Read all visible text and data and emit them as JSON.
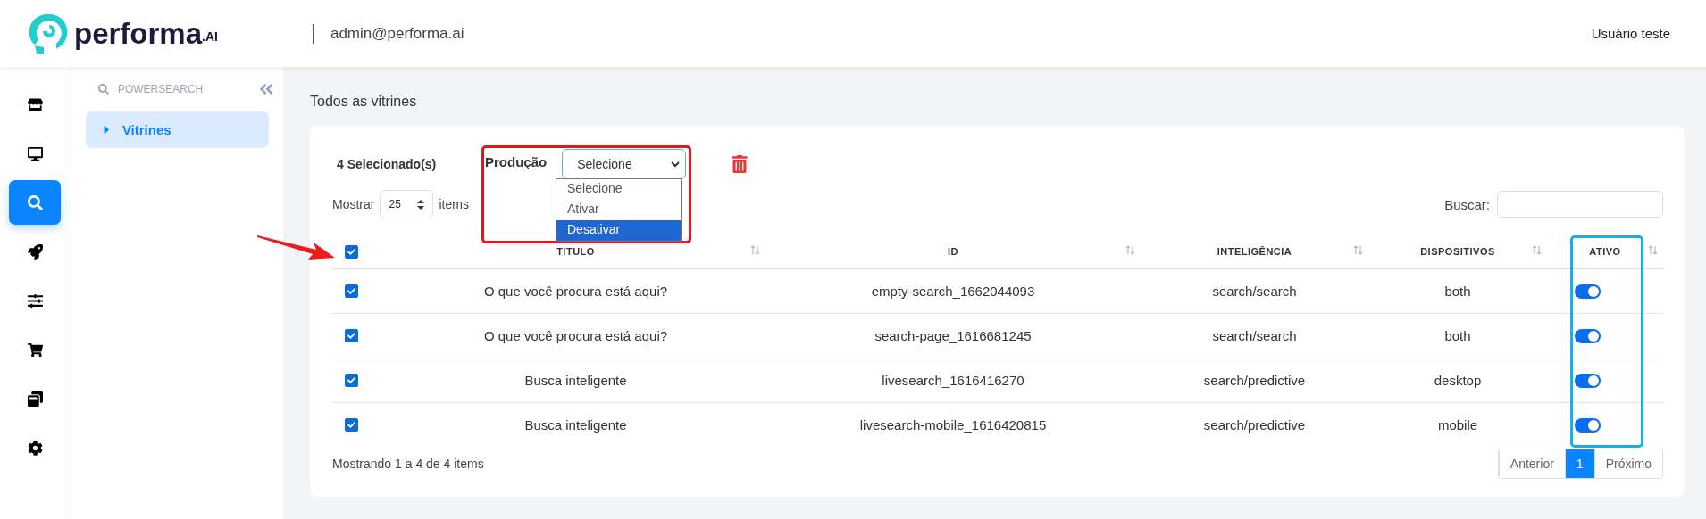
{
  "header": {
    "logo": {
      "name": "performa",
      "suffix": ".AI"
    },
    "account": "admin@performa.ai",
    "user": "Usuário teste"
  },
  "rail": [
    {
      "kind": "store",
      "selected": false
    },
    {
      "kind": "monitor",
      "selected": false
    },
    {
      "kind": "search",
      "selected": true
    },
    {
      "kind": "rocket",
      "selected": false
    },
    {
      "kind": "sliders",
      "selected": false
    },
    {
      "kind": "cart",
      "selected": false
    },
    {
      "kind": "windows",
      "selected": false
    },
    {
      "kind": "gear",
      "selected": false
    }
  ],
  "sidebar": {
    "section": "POWERSEARCH",
    "items": [
      {
        "label": "Vitrines",
        "selected": true
      }
    ]
  },
  "page_title": "Todos as vitrines",
  "bulk": {
    "count": "4 Selecionado(s)",
    "label": "Produção",
    "value": "Selecione",
    "options": [
      {
        "label": "Selecione",
        "highlighted": false
      },
      {
        "label": "Ativar",
        "highlighted": false
      },
      {
        "label": "Desativar",
        "highlighted": true
      }
    ]
  },
  "length": {
    "label": "Mostrar",
    "value": "25",
    "suffix": "items"
  },
  "search": {
    "label": "Buscar:"
  },
  "table": {
    "select_all": true,
    "columns": [
      "TITULO",
      "ID",
      "INTELIGÊNCIA",
      "DISPOSITIVOS",
      "ATIVO"
    ],
    "rows": [
      {
        "checked": true,
        "title": "O que você procura está aqui?",
        "id": "empty-search_1662044093",
        "intelligence": "search/search",
        "devices": "both",
        "active": true
      },
      {
        "checked": true,
        "title": "O que você procura está aqui?",
        "id": "search-page_1616681245",
        "intelligence": "search/search",
        "devices": "both",
        "active": true
      },
      {
        "checked": true,
        "title": "Busca inteligente",
        "id": "livesearch_1616416270",
        "intelligence": "search/predictive",
        "devices": "desktop",
        "active": true
      },
      {
        "checked": true,
        "title": "Busca inteligente",
        "id": "livesearch-mobile_1616420815",
        "intelligence": "search/predictive",
        "devices": "mobile",
        "active": true
      }
    ]
  },
  "info": "Mostrando 1 a 4 de 4 items",
  "pagination": [
    {
      "label": "Anterior",
      "selected": false
    },
    {
      "label": "1",
      "selected": true
    },
    {
      "label": "Próximo",
      "selected": false
    }
  ]
}
